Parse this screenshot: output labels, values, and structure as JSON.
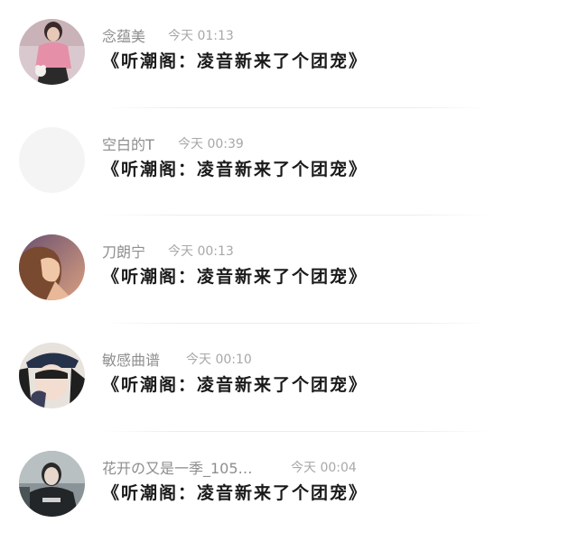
{
  "messages": [
    {
      "name": "念蕴美",
      "time": "今天 01:13",
      "text": "《听潮阁：凌音新来了个团宠》",
      "avatar_icon": "avatar-girl-pink-sweater"
    },
    {
      "name": "空白的T",
      "time": "今天 00:39",
      "text": "《听潮阁：凌音新来了个团宠》",
      "avatar_icon": "avatar-blank"
    },
    {
      "name": "刀朗宁",
      "time": "今天 00:13",
      "text": "《听潮阁：凌音新来了个团宠》",
      "avatar_icon": "avatar-girl-profile-sunset"
    },
    {
      "name": "敏感曲谱",
      "time": "今天 00:10",
      "text": "《听潮阁：凌音新来了个团宠》",
      "avatar_icon": "avatar-girl-cap"
    },
    {
      "name": "花开の又是一季_105…",
      "time": "今天 00:04",
      "text": "《听潮阁：凌音新来了个团宠》",
      "avatar_icon": "avatar-girl-dark-jacket"
    }
  ],
  "colors": {
    "name": "#8e8e8e",
    "time": "#a8a8a8",
    "message": "#1a1a1a",
    "divider": "#ececec"
  }
}
